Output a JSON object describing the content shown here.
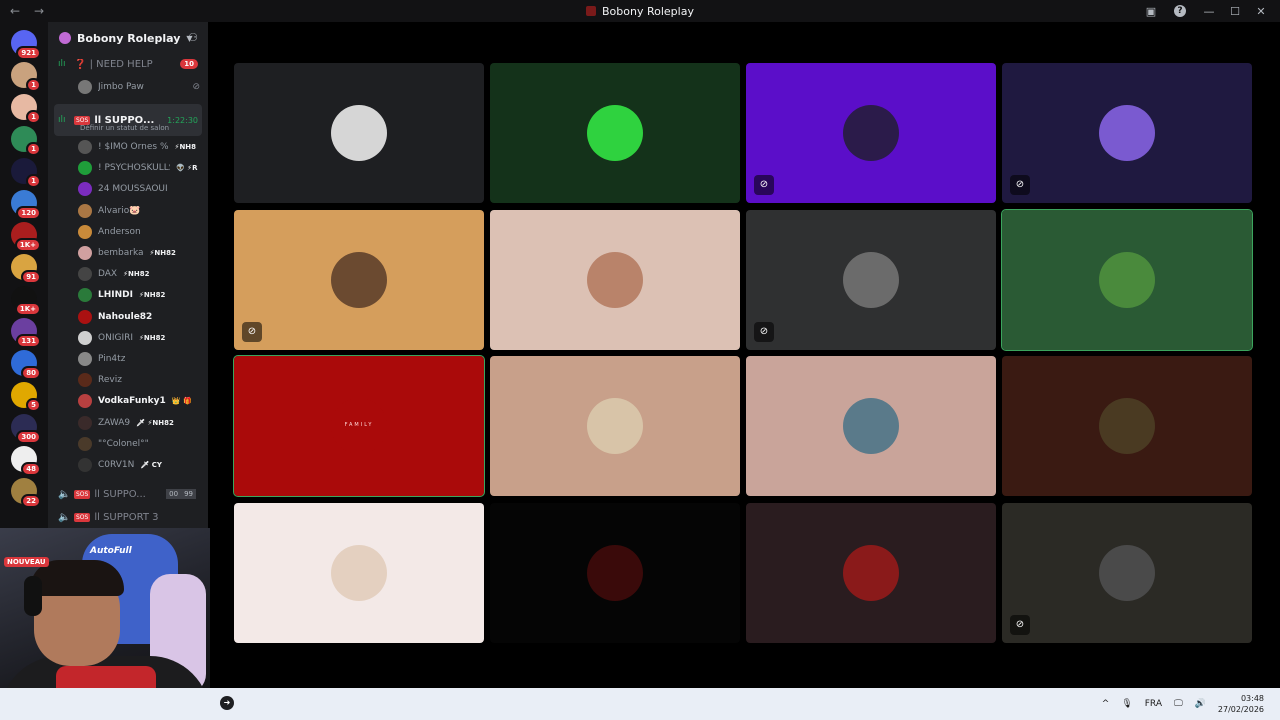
{
  "window": {
    "title": "Bobony Roleplay",
    "back": "←",
    "forward": "→",
    "inbox_icon": "▣",
    "help": "?",
    "minimize": "—",
    "maximize": "☐",
    "close": "✕"
  },
  "servers": [
    {
      "badge": "921",
      "color": "#5865f2"
    },
    {
      "badge": "1",
      "color": "#c9a27e"
    },
    {
      "badge": "1",
      "color": "#e7b9a3"
    },
    {
      "badge": "1",
      "color": "#2e8b57"
    },
    {
      "badge": "1",
      "color": "#1a1a3a"
    },
    {
      "badge": "120",
      "color": "#3a7bd5"
    },
    {
      "badge": "1K+",
      "color": "#aa1e1e"
    },
    {
      "badge": "91",
      "color": "#d9a441"
    },
    {
      "badge": "1K+",
      "color": "#111111"
    },
    {
      "badge": "131",
      "color": "#6b3fa0"
    },
    {
      "badge": "80",
      "color": "#2f6bd8"
    },
    {
      "badge": "5",
      "color": "#e0a800"
    },
    {
      "badge": "300",
      "color": "#2c2c54"
    },
    {
      "badge": "48",
      "color": "#eeeeee"
    },
    {
      "badge": "22",
      "color": "#a08040"
    }
  ],
  "sidebar": {
    "server_name": "Bobony Roleplay",
    "channels": {
      "need_help": {
        "label": "❓ | NEED HELP",
        "badge": "10"
      },
      "support_active": {
        "tag": "SOS",
        "label": "ll SUPPO...",
        "timer": "1:22:30",
        "status": "Définir un statut de salon"
      },
      "support2": {
        "tag": "SOS",
        "label": "ll SUPPO...",
        "count_a": "00",
        "count_b": "99"
      },
      "support3": {
        "tag": "SOS",
        "label": "ll SUPPORT 3"
      }
    },
    "need_help_member": "Jimbo Paw",
    "members": [
      {
        "name": "! $IMO Ornes %",
        "tag": "⚡NH8",
        "color": "#555555",
        "bright": false
      },
      {
        "name": "! PSYCHOSKULLS",
        "tag": "👽 ⚡R",
        "color": "#1f9e3a",
        "bright": false
      },
      {
        "name": "24 MOUSSAOUI",
        "tag": "",
        "color": "#7b2cbf",
        "bright": false
      },
      {
        "name": "Alvario🐷",
        "tag": "",
        "color": "#aa7744",
        "bright": false
      },
      {
        "name": "Anderson",
        "tag": "",
        "color": "#c98a3a",
        "bright": false
      },
      {
        "name": "bembarka",
        "tag": "⚡NH82",
        "color": "#d0a0a0",
        "bright": false
      },
      {
        "name": "DAX",
        "tag": "⚡NH82",
        "color": "#444444",
        "bright": false
      },
      {
        "name": "LHINDI",
        "tag": "⚡NH82",
        "color": "#2a7a3a",
        "bright": true
      },
      {
        "name": "Nahoule82",
        "tag": "",
        "color": "#aa1111",
        "bright": true
      },
      {
        "name": "ONIGIRI",
        "tag": "⚡NH82",
        "color": "#cfcfcf",
        "bright": false
      },
      {
        "name": "Pin4tz",
        "tag": "",
        "color": "#888888",
        "bright": false
      },
      {
        "name": "Reviz",
        "tag": "",
        "color": "#5a2a1a",
        "bright": false
      },
      {
        "name": "VodkaFunky1",
        "tag": "👑 🎁",
        "color": "#b84040",
        "bright": true
      },
      {
        "name": "ZAWA9",
        "tag": "🗡 ⚡NH82",
        "color": "#3a2a2a",
        "bright": false
      },
      {
        "name": "\"°Colonel°\"",
        "tag": "",
        "color": "#4a3a2a",
        "bright": false
      },
      {
        "name": "C0RV1N",
        "tag": "🗡 CY",
        "color": "#333333",
        "bright": false
      }
    ]
  },
  "webcam": {
    "badge": "NOUVEAU",
    "logo": "AutoFull"
  },
  "grid": {
    "tiles": [
      {
        "bg": "#1e1f22",
        "av": "#d6d6d6",
        "muted": false,
        "speaking": false
      },
      {
        "bg": "#14321a",
        "av": "#2fd23f",
        "muted": false,
        "speaking": false
      },
      {
        "bg": "#5b0ec9",
        "av": "#2b1b4a",
        "muted": true,
        "speaking": false
      },
      {
        "bg": "#1f1940",
        "av": "#7a5ad0",
        "muted": true,
        "speaking": false
      },
      {
        "bg": "#d59e5c",
        "av": "#6b4a30",
        "muted": true,
        "speaking": false
      },
      {
        "bg": "#dcc1b4",
        "av": "#b9836a",
        "muted": false,
        "speaking": false
      },
      {
        "bg": "#2f3031",
        "av": "#6b6b6b",
        "muted": true,
        "speaking": false
      },
      {
        "bg": "#2a5a34",
        "av": "#4a8a3c",
        "muted": false,
        "speaking": true
      },
      {
        "bg": "#aa0a0a",
        "av": "#aa0a0a",
        "muted": false,
        "speaking": true,
        "text": "FAMILY"
      },
      {
        "bg": "#c8a08a",
        "av": "#d8c4a8",
        "muted": false,
        "speaking": false
      },
      {
        "bg": "#c9a49a",
        "av": "#5a7a8a",
        "muted": false,
        "speaking": false
      },
      {
        "bg": "#3a1a12",
        "av": "#4a3a22",
        "muted": false,
        "speaking": false
      },
      {
        "bg": "#f3e9e7",
        "av": "#e4d0c0",
        "muted": false,
        "speaking": false
      },
      {
        "bg": "#050505",
        "av": "#3a0a0a",
        "muted": false,
        "speaking": false
      },
      {
        "bg": "#2a1c1f",
        "av": "#8a1a1a",
        "muted": false,
        "speaking": false
      },
      {
        "bg": "#2b2a25",
        "av": "#4a4a4a",
        "muted": true,
        "speaking": false
      }
    ]
  },
  "taskbar": {
    "chevron": "^",
    "mic": "🎙",
    "lang": "FRA",
    "monitor": "🖵",
    "volume": "🔊",
    "time": "03:48",
    "date": "27/02/2026"
  }
}
